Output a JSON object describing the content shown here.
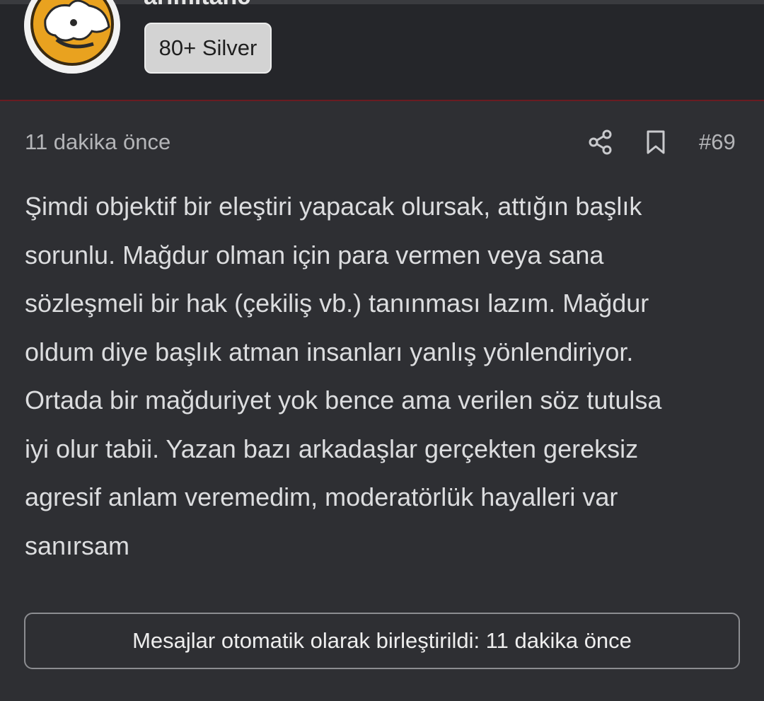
{
  "header": {
    "username": "arimitanc",
    "badge_label": "80+ Silver"
  },
  "post": {
    "time": "11 dakika önce",
    "number": "#69",
    "icons": {
      "share": "share-icon",
      "bookmark": "bookmark-icon"
    },
    "lines": [
      "Şimdi objektif bir eleştiri yapacak olursak, attığın başlık",
      "sorunlu. Mağdur olman için para vermen veya sana",
      "sözleşmeli bir hak (çekiliş vb.) tanınması lazım. Mağdur",
      "oldum diye başlık atman insanları yanlış yönlendiriyor.",
      "Ortada bir mağduriyet yok bence ama verilen söz tutulsa",
      "iyi olur tabii. Yazan bazı arkadaşlar gerçekten gereksiz",
      "agresif anlam veremedim, moderatörlük hayalleri var",
      "sanırsam"
    ],
    "merge_notice": "Mesajlar otomatik olarak birleştirildi: 11 dakika önce"
  },
  "colors": {
    "background": "#2e2f33",
    "header_background": "#25262a",
    "header_border": "#6a1c22",
    "badge_background": "#d3d3d3",
    "avatar_accent": "#e9a21f"
  }
}
